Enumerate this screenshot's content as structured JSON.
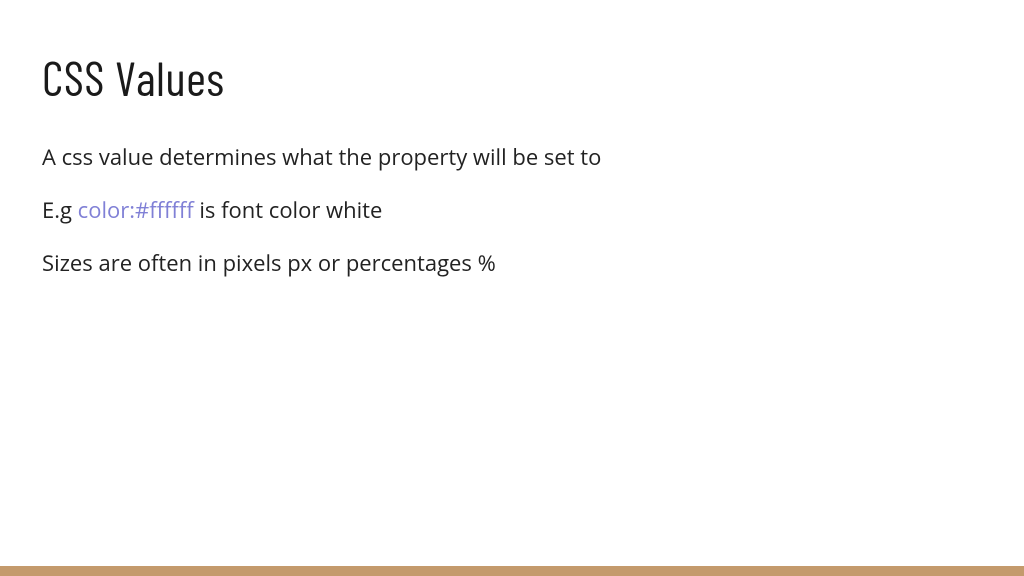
{
  "slide": {
    "title": "CSS Values",
    "line1": "A css value determines what the property will be set to",
    "line2_prefix": "E.g ",
    "line2_code": "color:#ffffff",
    "line2_suffix": " is font color white",
    "line3": "Sizes are often in pixels px or percentages %"
  }
}
